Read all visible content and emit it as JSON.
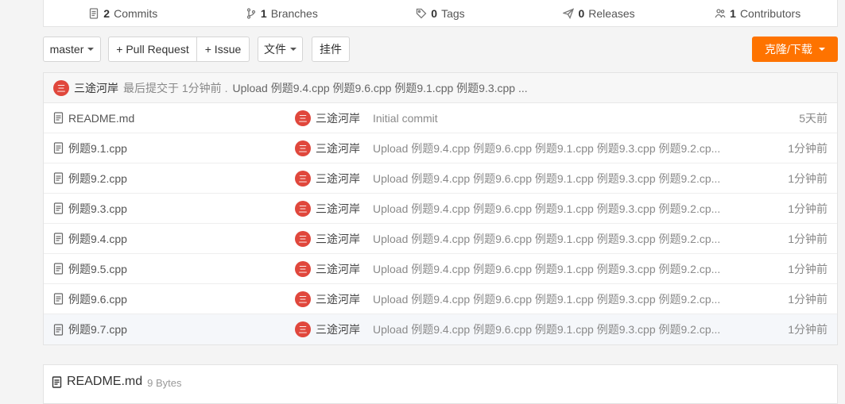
{
  "stats": [
    {
      "icon": "document-icon",
      "count": "2",
      "label": "Commits"
    },
    {
      "icon": "branch-icon",
      "count": "1",
      "label": "Branches"
    },
    {
      "icon": "tag-icon",
      "count": "0",
      "label": "Tags"
    },
    {
      "icon": "send-icon",
      "count": "0",
      "label": "Releases"
    },
    {
      "icon": "contributors-icon",
      "count": "1",
      "label": "Contributors"
    }
  ],
  "toolbar": {
    "branch": "master",
    "pull_request": "+ Pull Request",
    "issue": "+ Issue",
    "files": "文件",
    "widgets": "挂件",
    "clone": "克隆/下载"
  },
  "latest_commit": {
    "avatar": "三",
    "author": "三途河岸",
    "meta": "最后提交于 1分钟前 .",
    "message": "Upload 例题9.4.cpp 例题9.6.cpp 例题9.1.cpp 例题9.3.cpp ..."
  },
  "files": [
    {
      "name": "README.md",
      "avatar": "三",
      "author": "三途河岸",
      "message": "Initial commit",
      "time": "5天前"
    },
    {
      "name": "例题9.1.cpp",
      "avatar": "三",
      "author": "三途河岸",
      "message": "Upload 例题9.4.cpp 例题9.6.cpp 例题9.1.cpp 例题9.3.cpp 例题9.2.cp...",
      "time": "1分钟前"
    },
    {
      "name": "例题9.2.cpp",
      "avatar": "三",
      "author": "三途河岸",
      "message": "Upload 例题9.4.cpp 例题9.6.cpp 例题9.1.cpp 例题9.3.cpp 例题9.2.cp...",
      "time": "1分钟前"
    },
    {
      "name": "例题9.3.cpp",
      "avatar": "三",
      "author": "三途河岸",
      "message": "Upload 例题9.4.cpp 例题9.6.cpp 例题9.1.cpp 例题9.3.cpp 例题9.2.cp...",
      "time": "1分钟前"
    },
    {
      "name": "例题9.4.cpp",
      "avatar": "三",
      "author": "三途河岸",
      "message": "Upload 例题9.4.cpp 例题9.6.cpp 例题9.1.cpp 例题9.3.cpp 例题9.2.cp...",
      "time": "1分钟前"
    },
    {
      "name": "例题9.5.cpp",
      "avatar": "三",
      "author": "三途河岸",
      "message": "Upload 例题9.4.cpp 例题9.6.cpp 例题9.1.cpp 例题9.3.cpp 例题9.2.cp...",
      "time": "1分钟前"
    },
    {
      "name": "例题9.6.cpp",
      "avatar": "三",
      "author": "三途河岸",
      "message": "Upload 例题9.4.cpp 例题9.6.cpp 例题9.1.cpp 例题9.3.cpp 例题9.2.cp...",
      "time": "1分钟前"
    },
    {
      "name": "例题9.7.cpp",
      "avatar": "三",
      "author": "三途河岸",
      "message": "Upload 例题9.4.cpp 例题9.6.cpp 例题9.1.cpp 例题9.3.cpp 例题9.2.cp...",
      "time": "1分钟前"
    }
  ],
  "readme": {
    "title": "README.md",
    "size": "9 Bytes"
  },
  "colors": {
    "accent": "#fe7300",
    "avatar": "#e0473c"
  }
}
